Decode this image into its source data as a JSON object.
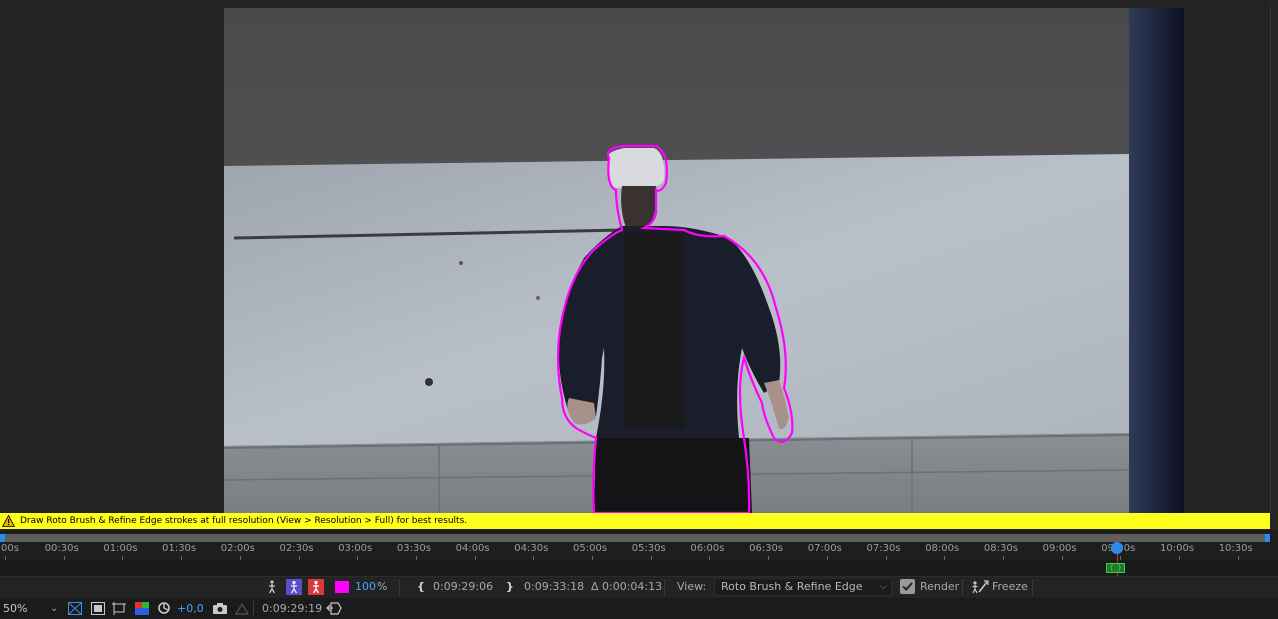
{
  "warning": {
    "message": "Draw Roto Brush & Refine Edge strokes at full resolution (View > Resolution > Full) for best results."
  },
  "timeline": {
    "ticks": [
      "00s",
      "00:30s",
      "01:00s",
      "01:30s",
      "02:00s",
      "02:30s",
      "03:00s",
      "03:30s",
      "04:00s",
      "04:30s",
      "05:00s",
      "05:30s",
      "06:00s",
      "06:30s",
      "07:00s",
      "07:30s",
      "08:00s",
      "08:30s",
      "09:00s",
      "09:30s",
      "10:00s",
      "10:30s"
    ],
    "playhead_time": "0:09:29:19"
  },
  "roto_bar": {
    "opacity_value": "100",
    "opacity_unit": "%",
    "in_time": "0:09:29:06",
    "out_time": "0:09:33:18",
    "duration": "Δ 0:00:04:13",
    "view_label": "View:",
    "view_value": "Roto Brush & Refine Edge",
    "render_label": "Render",
    "freeze_label": "Freeze"
  },
  "status_bar": {
    "zoom": "50%",
    "exposure": "+0,0",
    "timecode": "0:09:29:19"
  },
  "colors": {
    "accent_blue": "#2d8ceb",
    "outline_magenta": "#ff00ff",
    "warning_yellow": "#ffff1e"
  }
}
